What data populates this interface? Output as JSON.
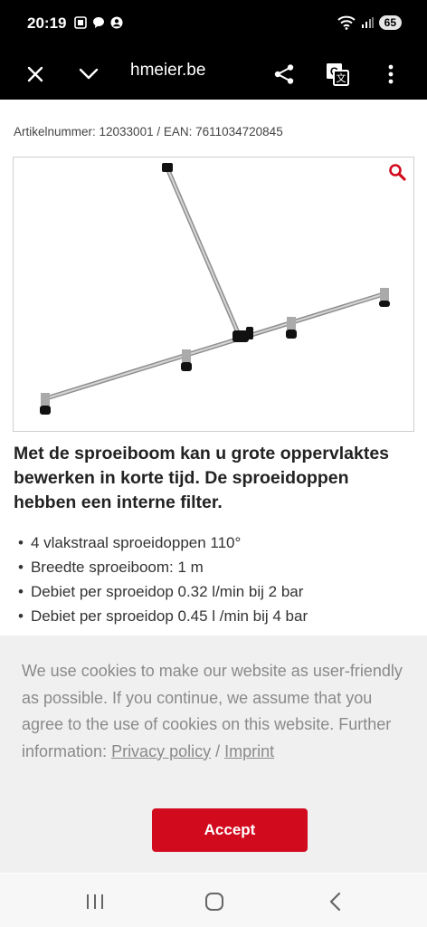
{
  "status_bar": {
    "time": "20:19",
    "battery": "65"
  },
  "browser": {
    "url": "hmeier.be"
  },
  "product": {
    "article_line": "Artikelnummer: 12033001 / EAN: 7611034720845",
    "lead": "Met de sproeiboom kan u grote oppervlaktes bewerken in korte tijd. De sproeidoppen hebben een interne filter.",
    "features": [
      "4 vlakstraal sproeidoppen 110°",
      "Breedte sproeiboom: 1 m",
      "Debiet per sproeidop 0.32 l/min bij 2 bar",
      "Debiet per sproeidop 0.45 l /min bij 4 bar"
    ]
  },
  "cookie": {
    "text": "We use cookies to make our website as user-friendly as possible. If you continue, we assume that you agree to the use of cookies on this website. Further information:",
    "privacy_link": "Privacy policy",
    "separator": " / ",
    "imprint_link": "Imprint",
    "accept_label": "Accept"
  },
  "colors": {
    "accent": "#d20a1e"
  }
}
